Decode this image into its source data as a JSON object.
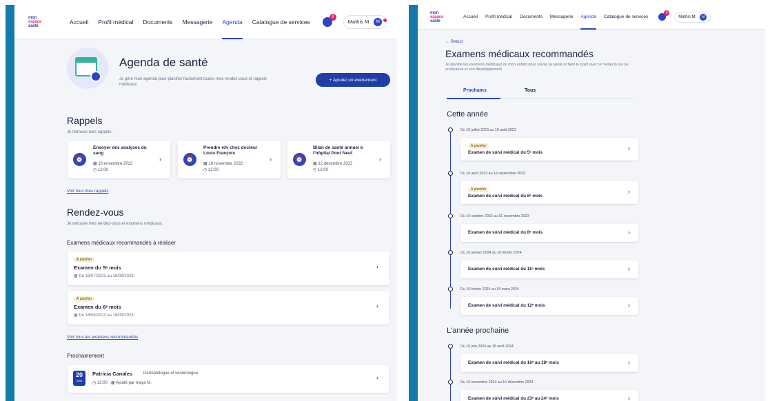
{
  "colors": {
    "accent": "#2b45c4",
    "primary_button": "#1f3ea8",
    "side_band": "#137aab",
    "badge": "#d6246d",
    "planned_badge_bg": "#fbeed0"
  },
  "logo": {
    "line1": "mon",
    "line2": "espace",
    "line3": "santé"
  },
  "nav": {
    "items": [
      "Accueil",
      "Profil médical",
      "Documents",
      "Messagerie",
      "Agenda",
      "Catalogue de services"
    ],
    "active": "Agenda",
    "notif_count": "9",
    "user_name": "Mathis M.",
    "user_initial": "M"
  },
  "agenda": {
    "title": "Agenda de santé",
    "description": "Je gère mon agenda pour planifier facilement toutes mes rendez-vous et rappels médicaux",
    "add_button": "+ Ajouter un événement"
  },
  "reminders": {
    "title": "Rappels",
    "subtitle": "Je retrouve mes rappels.",
    "items": [
      {
        "title": "Envoyer des analyses du sang",
        "date": "16 novembre 2022",
        "time": "12:00"
      },
      {
        "title": "Prendre rdv chez docteur Louis François",
        "date": "18 novembre 2022",
        "time": "12:00"
      },
      {
        "title": "Bilan de santé annuel à l'hôpital Pont Neuf",
        "date": "12 décembre 2022",
        "time": "12:00"
      }
    ],
    "see_all": "Voir tous mes rappels"
  },
  "appointments": {
    "title": "Rendez-vous",
    "subtitle": "Je retrouve mes rendez-vous et examens médicaux.",
    "exams_heading": "Examens médicaux recommandés à réaliser",
    "exams": [
      {
        "badge": "À planifier",
        "title": "Examen du 5ᵉ mois",
        "dates": "Du 16/07/2023 au 16/08/2023"
      },
      {
        "badge": "À planifier",
        "title": "Examen du 6ᵉ mois",
        "dates": "Du 16/08/2023 au 16/09/2023"
      }
    ],
    "see_all_exams": "Voir tous les examens recommandés",
    "upcoming_heading": "Prochainement",
    "upcoming": {
      "day": "20",
      "month": "JUIN",
      "name": "Patricia Canales",
      "specialty": "Dermatologue et vénérologue",
      "time": "12:00",
      "added_by": "Ajouté par Inaya M."
    }
  },
  "exams_page": {
    "back": "← Retour",
    "title": "Examens médicaux recommandés",
    "description": "Je planifie les examens médicaux de mon enfant pour suivre sa santé et faire le point avec le médecin sur sa croissance et son développement.",
    "tabs": [
      "Prochains",
      "Tous"
    ],
    "this_year": "Cette année",
    "next_year": "L'année prochaine",
    "timeline": [
      {
        "dates": "Du 16 juillet 2023 au 16 août 2023",
        "badge": "À planifier",
        "title": "Examen de suivi médical du 5ᵉ mois"
      },
      {
        "dates": "Du 16 août 2023 au 16 septembre 2023",
        "badge": "À planifier",
        "title": "Examen de suivi médical du 6ᵉ mois"
      },
      {
        "dates": "Du 16 octobre 2023 au 16 novembre 2023",
        "badge": "",
        "title": "Examen de suivi médical du 8ᵉ mois"
      },
      {
        "dates": "Du 16 janvier 2024 au 16 février 2024",
        "badge": "",
        "title": "Examen de suivi médical du 11ᵉ mois"
      },
      {
        "dates": "Du 16 février 2024 au 16 mars 2024",
        "badge": "",
        "title": "Examen de suivi médical du 12ᵉ mois"
      }
    ],
    "timeline_next": [
      {
        "dates": "Du 16 juin 2024 au 16 août 2024",
        "title": "Examen de suivi médical du 16ᵉ au 18ᵉ mois"
      },
      {
        "dates": "Du 16 novembre 2024 au 16 décembre 2024",
        "title": "Examen de suivi médical du 23ᵉ au 24ᵉ mois"
      }
    ]
  }
}
